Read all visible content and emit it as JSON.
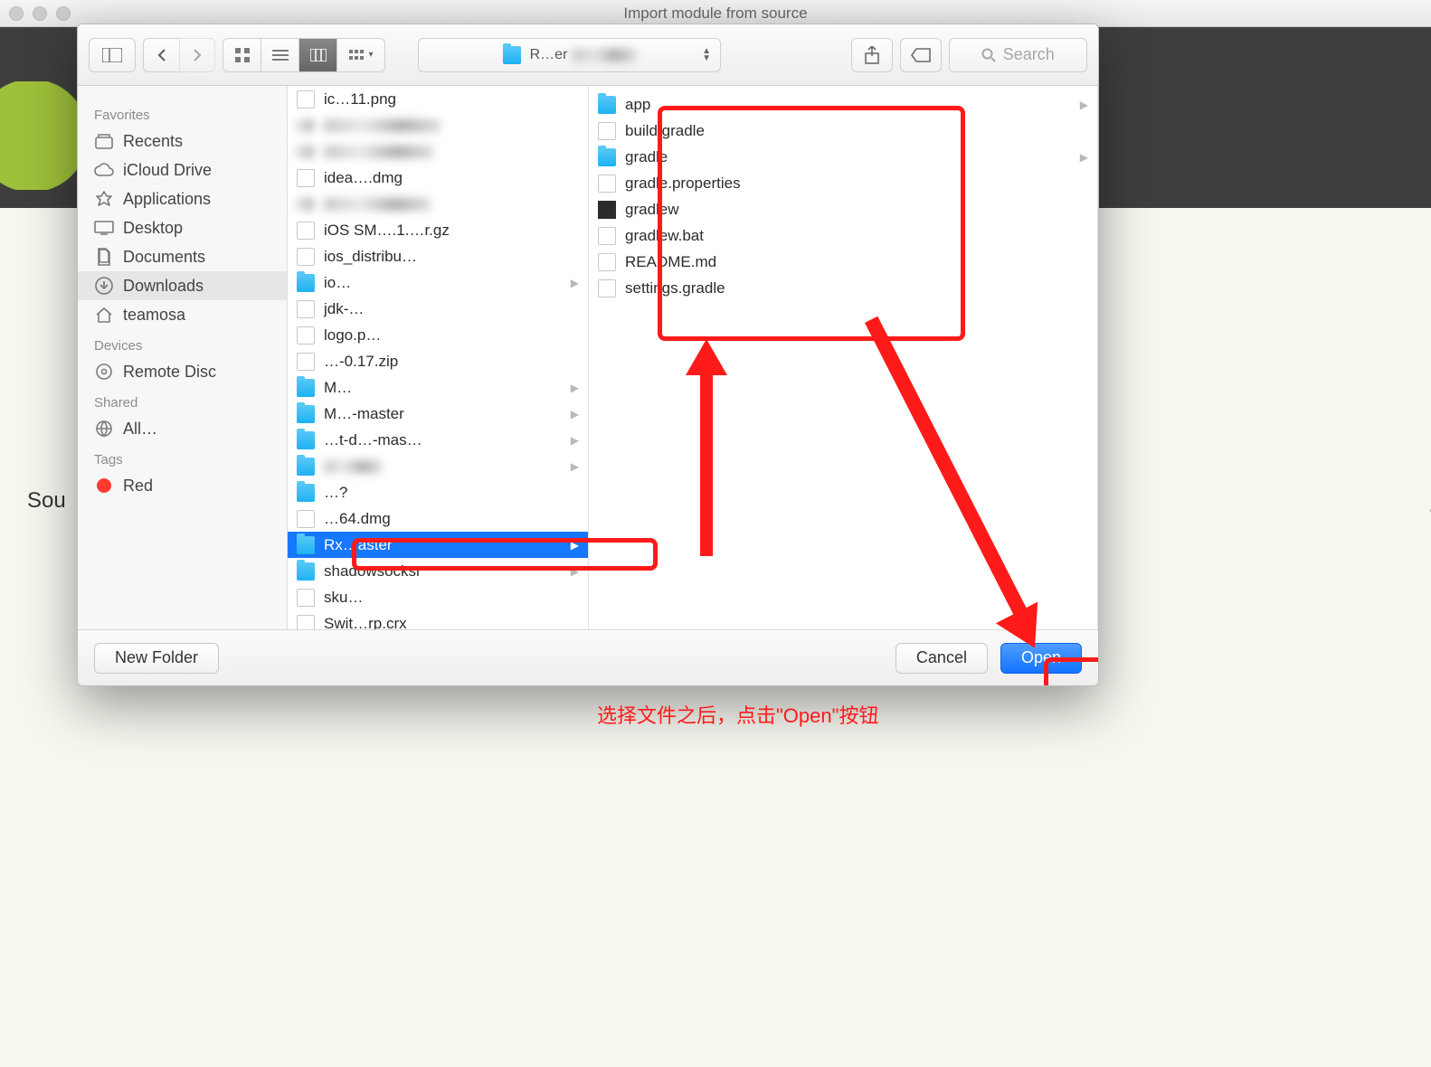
{
  "window": {
    "title": "Import module from source"
  },
  "toolbar": {
    "path_label": "R…er",
    "search_placeholder": "Search"
  },
  "background": {
    "sou_label": "Sou"
  },
  "sidebar": {
    "favorites_head": "Favorites",
    "devices_head": "Devices",
    "shared_head": "Shared",
    "tags_head": "Tags",
    "items": [
      {
        "label": "Recents"
      },
      {
        "label": "iCloud Drive"
      },
      {
        "label": "Applications"
      },
      {
        "label": "Desktop"
      },
      {
        "label": "Documents"
      },
      {
        "label": "Downloads"
      },
      {
        "label": "teamosa"
      }
    ],
    "devices": [
      {
        "label": "Remote Disc"
      }
    ],
    "shared": [
      {
        "label": "All…"
      }
    ],
    "tags": [
      {
        "label": "Red"
      }
    ]
  },
  "col1": [
    {
      "type": "doc",
      "label": "ic…11.png"
    },
    {
      "type": "blur",
      "label": ""
    },
    {
      "type": "blur",
      "label": ""
    },
    {
      "type": "doc",
      "label": "idea….dmg"
    },
    {
      "type": "blur",
      "label": ""
    },
    {
      "type": "doc",
      "label": "iOS SM….1.…r.gz"
    },
    {
      "type": "doc",
      "label": "ios_distribu…"
    },
    {
      "type": "folder",
      "label": "io…",
      "arrow": true
    },
    {
      "type": "doc",
      "label": "jdk-…"
    },
    {
      "type": "doc",
      "label": "logo.p…"
    },
    {
      "type": "doc",
      "label": "…-0.17.zip"
    },
    {
      "type": "folder",
      "label": "M…",
      "arrow": true
    },
    {
      "type": "folder",
      "label": "M…-master",
      "arrow": true
    },
    {
      "type": "folder",
      "label": "…t-d…-mas…",
      "arrow": true
    },
    {
      "type": "folder",
      "label": "",
      "arrow": true
    },
    {
      "type": "folder",
      "label": "…?"
    },
    {
      "type": "doc",
      "label": "…64.dmg"
    },
    {
      "type": "folder",
      "label": "Rx…aster",
      "arrow": true,
      "selected": true
    },
    {
      "type": "folder",
      "label": "shadowsocksr",
      "arrow": true
    },
    {
      "type": "doc",
      "label": "sku…"
    },
    {
      "type": "doc",
      "label": "Swit…rp.crx"
    }
  ],
  "col2": [
    {
      "type": "folder",
      "label": "app",
      "arrow": true
    },
    {
      "type": "doc",
      "label": "build.gradle"
    },
    {
      "type": "folder",
      "label": "gradle",
      "arrow": true
    },
    {
      "type": "doc",
      "label": "gradle.properties"
    },
    {
      "type": "exec",
      "label": "gradlew"
    },
    {
      "type": "doc",
      "label": "gradlew.bat"
    },
    {
      "type": "doc",
      "label": "README.md"
    },
    {
      "type": "doc",
      "label": "settings.gradle"
    }
  ],
  "footer": {
    "new_folder": "New Folder",
    "cancel": "Cancel",
    "open": "Open"
  },
  "annotation": {
    "caption": "选择文件之后，点击\"Open\"按钮"
  }
}
